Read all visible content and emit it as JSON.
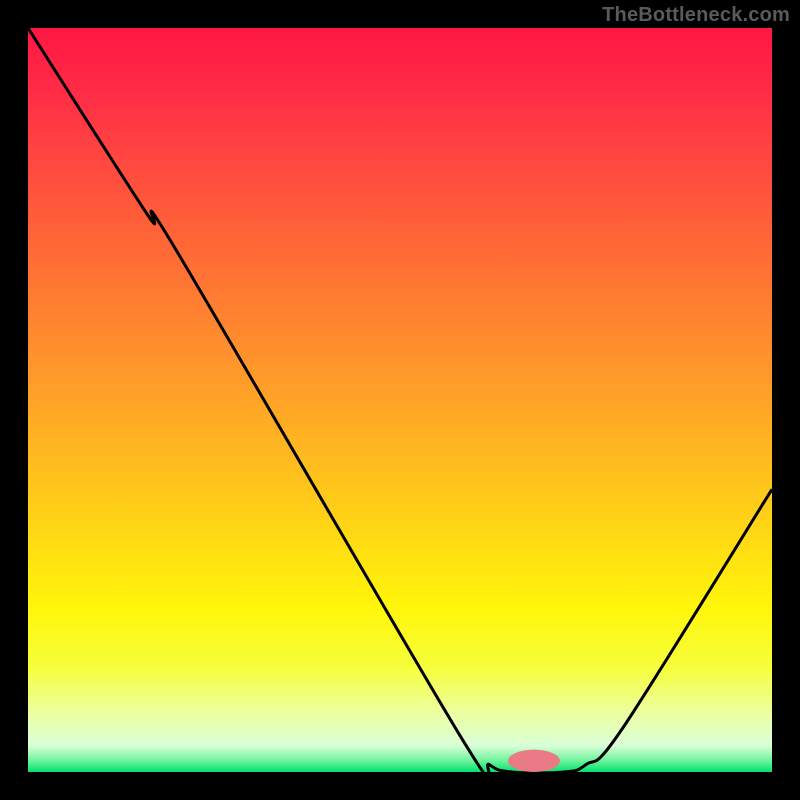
{
  "watermark": "TheBottleneck.com",
  "colors": {
    "frame_bg": "#000000",
    "watermark": "#5a5a5a",
    "curve": "#000000",
    "marker_fill": "#eb7a87",
    "gradient_stops": [
      {
        "offset": 0.0,
        "color": "#ff1744"
      },
      {
        "offset": 0.08,
        "color": "#ff2a46"
      },
      {
        "offset": 0.18,
        "color": "#ff4840"
      },
      {
        "offset": 0.3,
        "color": "#ff6a36"
      },
      {
        "offset": 0.42,
        "color": "#ff8c2e"
      },
      {
        "offset": 0.55,
        "color": "#ffb222"
      },
      {
        "offset": 0.68,
        "color": "#ffd814"
      },
      {
        "offset": 0.78,
        "color": "#fff60a"
      },
      {
        "offset": 0.86,
        "color": "#f6ff3c"
      },
      {
        "offset": 0.92,
        "color": "#ecffa0"
      },
      {
        "offset": 0.965,
        "color": "#d8ffd8"
      },
      {
        "offset": 0.985,
        "color": "#6cf39a"
      },
      {
        "offset": 1.0,
        "color": "#00e170"
      }
    ]
  },
  "chart_data": {
    "type": "line",
    "title": "",
    "xlabel": "",
    "ylabel": "",
    "xlim": [
      0,
      100
    ],
    "ylim": [
      0,
      100
    ],
    "curve_points": [
      {
        "x": 0,
        "y": 100
      },
      {
        "x": 16,
        "y": 75
      },
      {
        "x": 20,
        "y": 70
      },
      {
        "x": 58,
        "y": 5
      },
      {
        "x": 62,
        "y": 1
      },
      {
        "x": 65,
        "y": 0
      },
      {
        "x": 72,
        "y": 0
      },
      {
        "x": 75,
        "y": 1
      },
      {
        "x": 80,
        "y": 6
      },
      {
        "x": 100,
        "y": 38
      }
    ],
    "marker": {
      "x": 68,
      "y": 1.5,
      "rx": 3.5,
      "ry": 1.5
    }
  }
}
